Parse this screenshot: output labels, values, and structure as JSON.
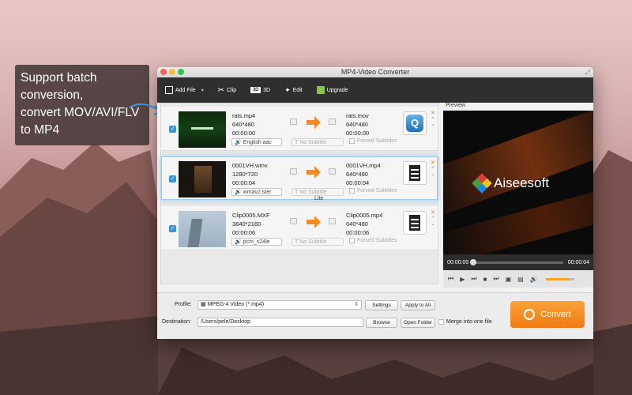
{
  "callout": {
    "lines": [
      "Support batch",
      "conversion,",
      "convert MOV/AVI/FLV",
      "to MP4"
    ]
  },
  "window": {
    "title": "MP4-Video Converter"
  },
  "toolbar": {
    "add_file": "Add File",
    "clip": "Clip",
    "threed_icon": "3D",
    "threed": "3D",
    "edit": "Edit",
    "upgrade": "Upgrade"
  },
  "files": [
    {
      "src_name": "rats.mp4",
      "src_res": "640*480",
      "src_dur": "00:00:00",
      "dst_name": "rats.mov",
      "dst_res": "640*480",
      "dst_dur": "00:00:00",
      "audio": "English aac",
      "subtitle": "No Subtitle",
      "forced": "Forced Subtitles",
      "format_icon": "quicktime-icon",
      "format_glyph": "Q"
    },
    {
      "src_name": "0001VH.wmv",
      "src_res": "1280*720",
      "src_dur": "00:00:04",
      "dst_name": "0001VH.mp4",
      "dst_res": "640*480",
      "dst_dur": "00:00:04",
      "audio": "wmav2 ster",
      "subtitle": "No Subtitle",
      "forced": "Forced Subtitles",
      "format_icon": "film-icon"
    },
    {
      "src_name": "Clip0005.MXF",
      "src_res": "3840*2160",
      "src_dur": "00:00:06",
      "dst_name": "Clip0005.mp4",
      "dst_res": "640*480",
      "dst_dur": "00:00:06",
      "audio": "pcm_s24le",
      "subtitle": "No Subtitle",
      "forced": "Forced Subtitles",
      "format_icon": "film-icon"
    }
  ],
  "lite_label": "Lite",
  "preview": {
    "label": "Preview",
    "brand": "Aiseesoft",
    "time_start": "00:00:00",
    "time_end": "00:00:04",
    "progress": 0.0,
    "volume": 0.8
  },
  "bottom": {
    "profile_label": "Profile:",
    "profile_value": "MPEG-4 Video (*.mp4)",
    "settings": "Settings",
    "apply_all": "Apply to All",
    "destination_label": "Destination:",
    "destination_value": "/Users/pele/Desktop",
    "browse": "Browse",
    "open_folder": "Open Folder",
    "merge": "Merge into one file",
    "convert": "Convert"
  },
  "colors": {
    "accent": "#f5a623",
    "convert": "#ef7b12",
    "checkbox": "#3b94d9"
  }
}
